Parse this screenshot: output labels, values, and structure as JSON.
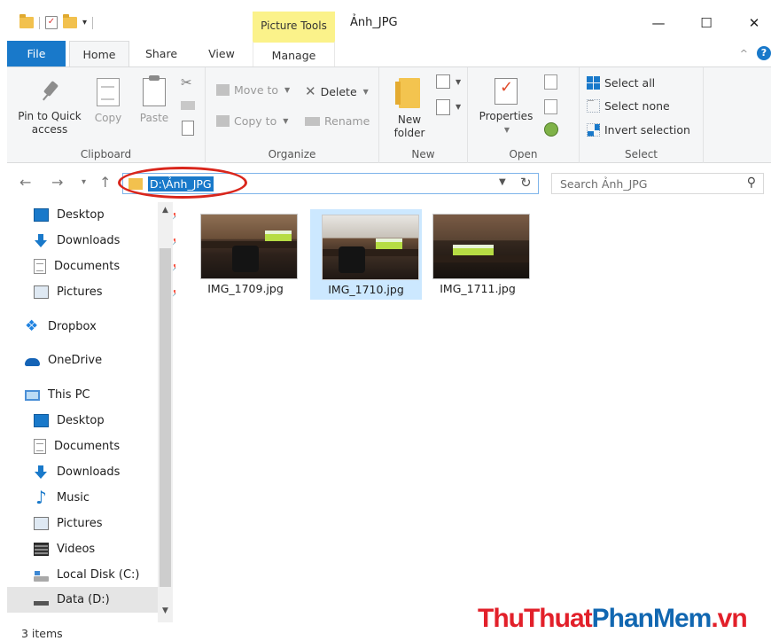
{
  "window": {
    "title": "Ảnh_JPG",
    "context_tab": "Picture Tools",
    "minimize": "—",
    "maximize": "☐",
    "close": "✕"
  },
  "tabs": [
    {
      "label": "File"
    },
    {
      "label": "Home"
    },
    {
      "label": "Share"
    },
    {
      "label": "View"
    },
    {
      "label": "Manage"
    }
  ],
  "ribbon": {
    "clipboard": {
      "label": "Clipboard",
      "pin": "Pin to Quick access",
      "pin_line1": "Pin to Quick",
      "pin_line2": "access",
      "copy": "Copy",
      "paste": "Paste"
    },
    "organize": {
      "label": "Organize",
      "move_to": "Move to",
      "copy_to": "Copy to",
      "delete": "Delete",
      "rename": "Rename"
    },
    "new": {
      "label": "New",
      "new_folder_line1": "New",
      "new_folder_line2": "folder"
    },
    "open": {
      "label": "Open",
      "properties": "Properties"
    },
    "select": {
      "label": "Select",
      "select_all": "Select all",
      "select_none": "Select none",
      "invert": "Invert selection"
    }
  },
  "address": {
    "path": "D:\\Ảnh_JPG",
    "search_placeholder": "Search Ảnh_JPG"
  },
  "nav": {
    "quick_access": [
      {
        "label": "Desktop",
        "icon": "desktop-icon",
        "pinned": true
      },
      {
        "label": "Downloads",
        "icon": "download-icon",
        "pinned": true
      },
      {
        "label": "Documents",
        "icon": "documents-icon",
        "pinned": true
      },
      {
        "label": "Pictures",
        "icon": "pictures-icon",
        "pinned": true
      }
    ],
    "dropbox": "Dropbox",
    "onedrive": "OneDrive",
    "this_pc": "This PC",
    "pc_items": [
      {
        "label": "Desktop",
        "icon": "desktop-icon"
      },
      {
        "label": "Documents",
        "icon": "documents-icon"
      },
      {
        "label": "Downloads",
        "icon": "download-icon"
      },
      {
        "label": "Music",
        "icon": "music-icon"
      },
      {
        "label": "Pictures",
        "icon": "pictures-icon"
      },
      {
        "label": "Videos",
        "icon": "videos-icon"
      },
      {
        "label": "Local Disk (C:)",
        "icon": "local-disk-icon"
      },
      {
        "label": "Data (D:)",
        "icon": "data-drive-icon",
        "selected": true
      }
    ]
  },
  "files": [
    {
      "name": "IMG_1709.jpg",
      "selected": false
    },
    {
      "name": "IMG_1710.jpg",
      "selected": true
    },
    {
      "name": "IMG_1711.jpg",
      "selected": false
    }
  ],
  "status": {
    "items": "3 items"
  },
  "watermark": {
    "part1": "ThuThuat",
    "part2": "PhanMem",
    "part3": ".vn"
  },
  "colors": {
    "accent": "#1979ca",
    "context_tab": "#fbf28a",
    "callout": "#d9261c",
    "selection": "#cce8ff"
  }
}
